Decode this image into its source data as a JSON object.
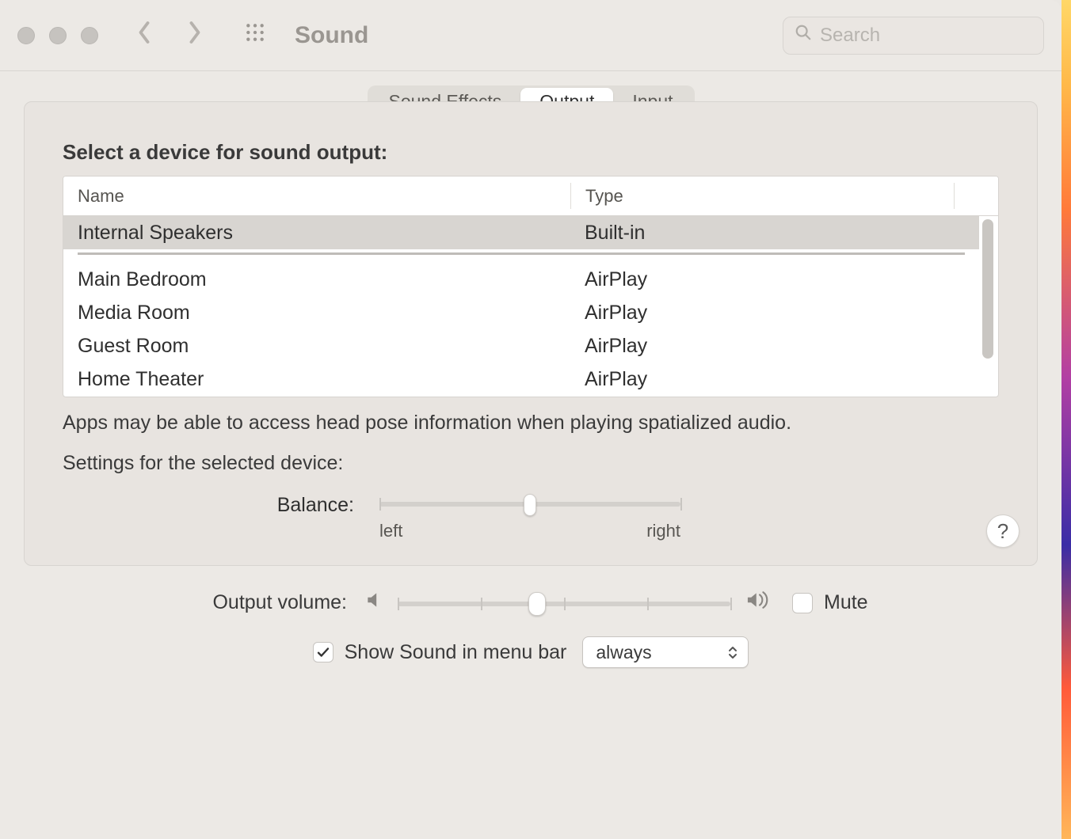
{
  "window": {
    "title": "Sound"
  },
  "search": {
    "placeholder": "Search"
  },
  "tabs": [
    {
      "label": "Sound Effects",
      "active": false
    },
    {
      "label": "Output",
      "active": true
    },
    {
      "label": "Input",
      "active": false
    }
  ],
  "section_title": "Select a device for sound output:",
  "columns": {
    "name": "Name",
    "type": "Type"
  },
  "devices_group1": [
    {
      "name": "Internal Speakers",
      "type": "Built-in",
      "selected": true
    }
  ],
  "devices_group2": [
    {
      "name": "Main Bedroom",
      "type": "AirPlay"
    },
    {
      "name": "Media Room",
      "type": "AirPlay"
    },
    {
      "name": "Guest Room",
      "type": "AirPlay"
    },
    {
      "name": "Home Theater",
      "type": "AirPlay"
    }
  ],
  "spatial_note": "Apps may be able to access head pose information when playing spatialized audio.",
  "settings_title": "Settings for the selected device:",
  "balance": {
    "label": "Balance:",
    "left": "left",
    "right": "right",
    "value": 50
  },
  "help_glyph": "?",
  "output": {
    "label": "Output volume:",
    "value": 42,
    "mute_label": "Mute",
    "mute_checked": false
  },
  "menubar": {
    "checkbox_label": "Show Sound in menu bar",
    "checked": true,
    "select_value": "always"
  }
}
